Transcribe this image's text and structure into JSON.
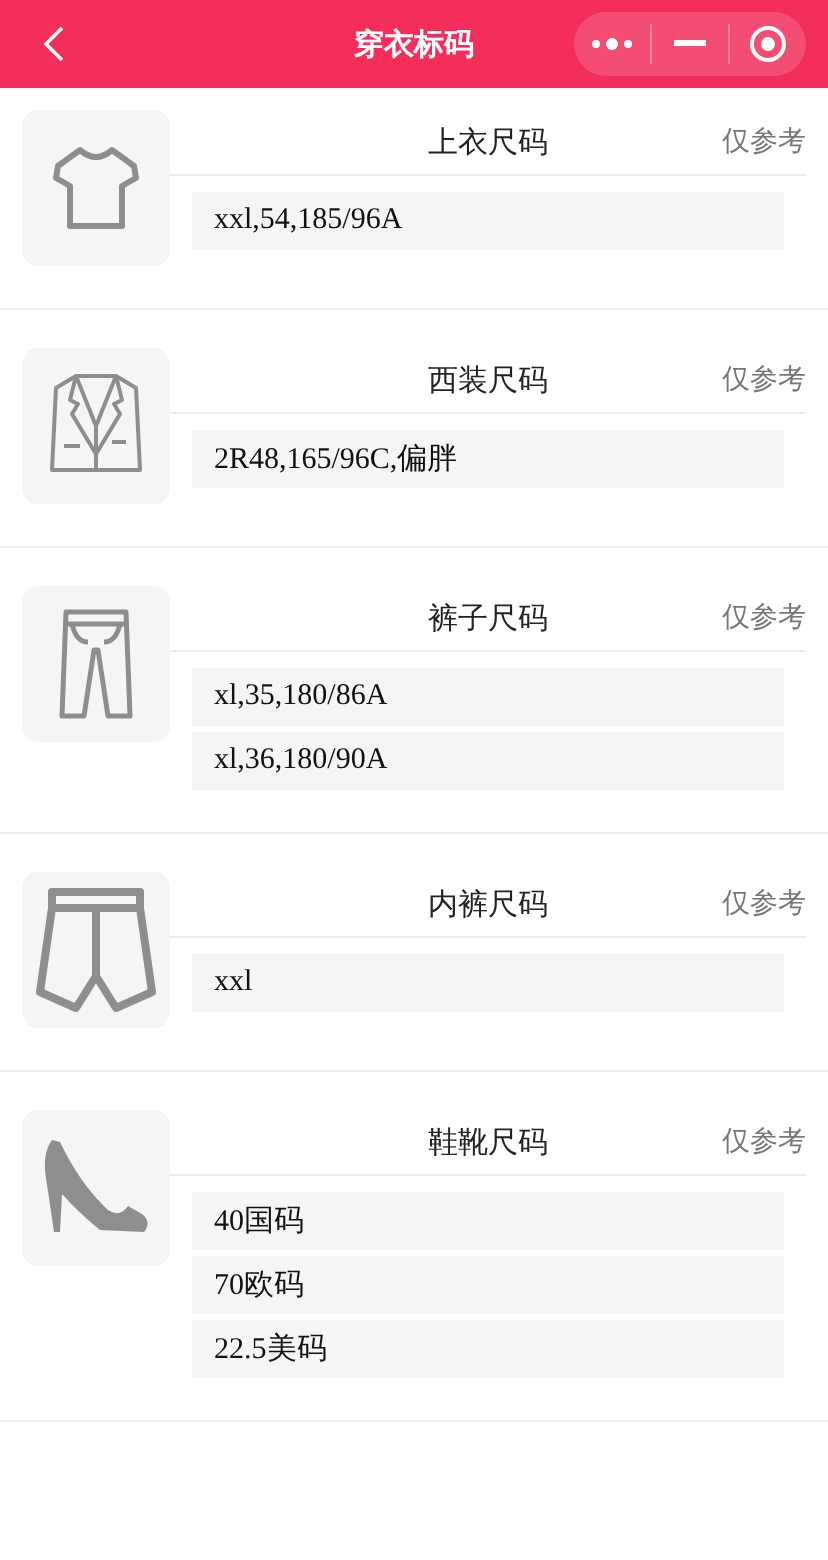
{
  "nav_bar": {
    "title": "穿衣标码"
  },
  "sections": [
    {
      "kind": "top",
      "title": "上衣尺码",
      "note": "仅参考",
      "values": [
        "xxl,54,185/96A"
      ]
    },
    {
      "kind": "suit",
      "title": "西装尺码",
      "note": "仅参考",
      "values": [
        "2R48,165/96C,偏胖"
      ]
    },
    {
      "kind": "pants",
      "title": "裤子尺码",
      "note": "仅参考",
      "values": [
        "xl,35,180/86A",
        "xl,36,180/90A"
      ]
    },
    {
      "kind": "underwear",
      "title": "内裤尺码",
      "note": "仅参考",
      "values": [
        "xxl"
      ]
    },
    {
      "kind": "shoes",
      "title": "鞋靴尺码",
      "note": "仅参考",
      "values": [
        "40国码",
        "70欧码",
        "22.5美码"
      ]
    }
  ]
}
